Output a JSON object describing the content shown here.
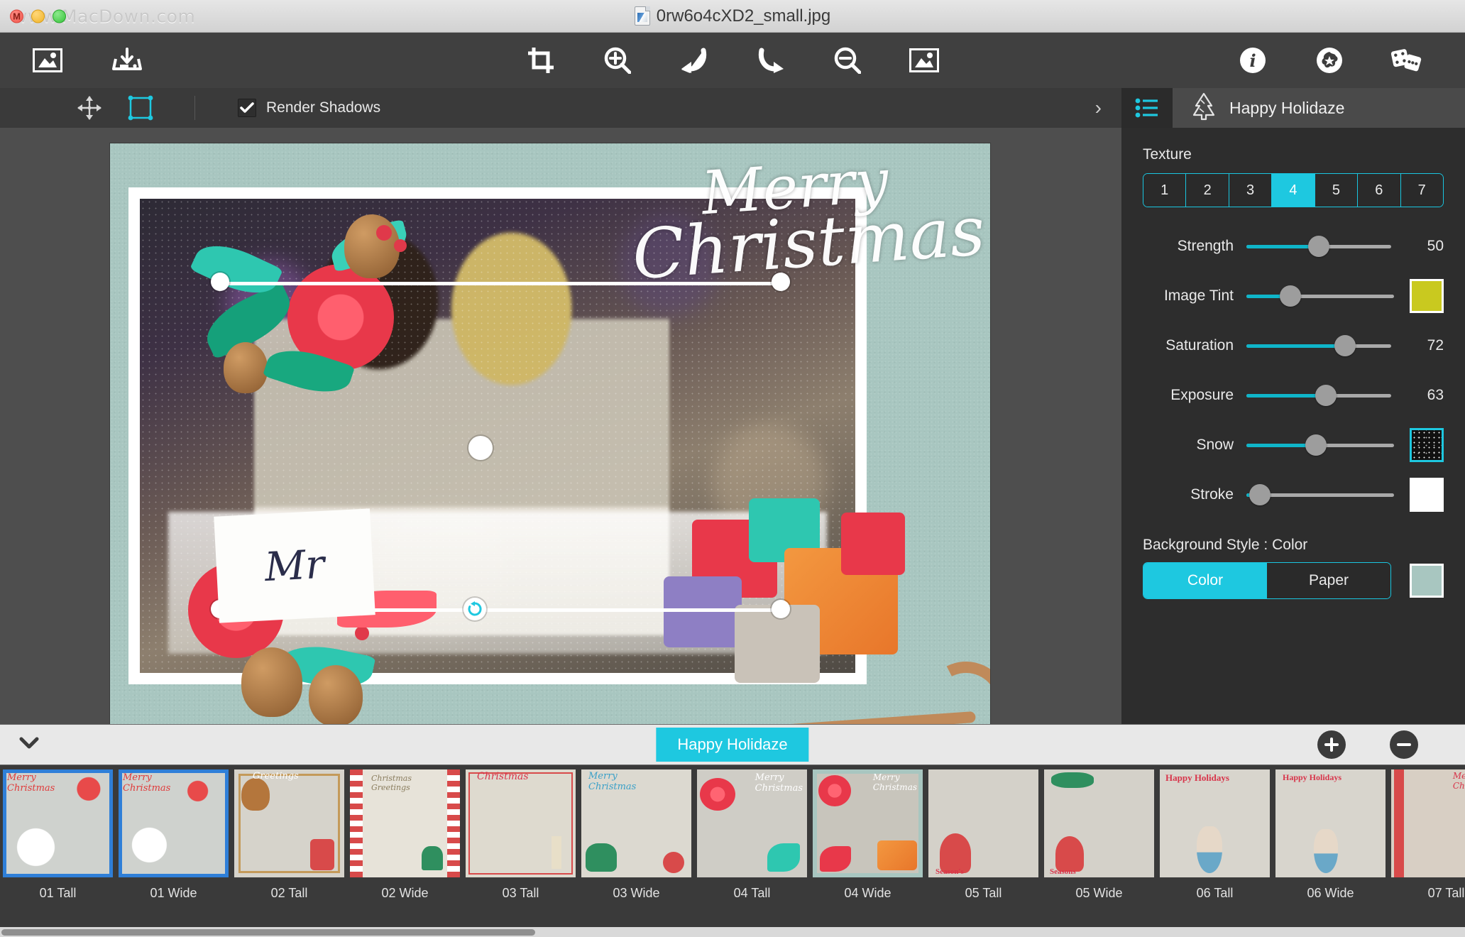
{
  "window": {
    "title": "0rw6o4cXD2_small.jpg",
    "watermark": "www.MacDown.com",
    "traffic_lights": [
      "close-red",
      "minimize-yellow",
      "zoom-green"
    ],
    "accent_color": "#1ec8e0"
  },
  "toolbar": {
    "left": [
      {
        "name": "open-image-icon",
        "label": "Open Image"
      },
      {
        "name": "save-image-icon",
        "label": "Save Image"
      }
    ],
    "center": [
      {
        "name": "crop-icon",
        "label": "Crop"
      },
      {
        "name": "zoom-in-icon",
        "label": "Zoom In"
      },
      {
        "name": "undo-icon",
        "label": "Undo"
      },
      {
        "name": "redo-icon",
        "label": "Redo"
      },
      {
        "name": "zoom-out-icon",
        "label": "Zoom Out"
      },
      {
        "name": "fit-image-icon",
        "label": "Fit Image"
      }
    ],
    "right": [
      {
        "name": "info-icon",
        "label": "Info"
      },
      {
        "name": "effects-icon",
        "label": "Effects"
      },
      {
        "name": "randomize-dice-icon",
        "label": "Randomize"
      }
    ]
  },
  "options_bar": {
    "move_tool": "move-tool",
    "transform_tool": "transform-tool",
    "render_shadows_label": "Render Shadows",
    "render_shadows_checked": true,
    "expand_chevron": "›"
  },
  "panel_header": {
    "list_icon": "list-icon",
    "tree_icon": "christmas-tree-icon",
    "title": "Happy Holidaze"
  },
  "panel": {
    "texture": {
      "label": "Texture",
      "options": [
        "1",
        "2",
        "3",
        "4",
        "5",
        "6",
        "7"
      ],
      "selected": "4"
    },
    "sliders": [
      {
        "label": "Strength",
        "value": 50,
        "percent": 50,
        "show_value": true,
        "swatch": null
      },
      {
        "label": "Image Tint",
        "value": 30,
        "percent": 30,
        "show_value": false,
        "swatch": "#c9c91f"
      },
      {
        "label": "Saturation",
        "value": 72,
        "percent": 72,
        "show_value": true,
        "swatch": null
      },
      {
        "label": "Exposure",
        "value": 63,
        "percent": 63,
        "show_value": true,
        "swatch": null
      },
      {
        "label": "Snow",
        "value": 47,
        "percent": 47,
        "show_value": false,
        "swatch": "noise"
      },
      {
        "label": "Stroke",
        "value": 9,
        "percent": 9,
        "show_value": false,
        "swatch": "#ffffff"
      }
    ],
    "background_style": {
      "label": "Background Style : Color",
      "options": [
        "Color",
        "Paper"
      ],
      "selected": "Color",
      "color": "#a8c6c0"
    }
  },
  "canvas": {
    "background_color": "#a8c6c0",
    "greeting_line1": "Merry",
    "greeting_line2": "Christmas",
    "monogram": "Mr",
    "selection_handles": 4,
    "rotate_handle_icon": "rotate-icon"
  },
  "filmstrip": {
    "collapse_icon": "chevron-down-icon",
    "active_tab": "Happy Holidaze",
    "add_button": "add-icon",
    "remove_button": "remove-icon",
    "templates": [
      {
        "label": "01 Tall",
        "selected": false,
        "focused": true
      },
      {
        "label": "01 Wide",
        "selected": false,
        "focused": true
      },
      {
        "label": "02 Tall",
        "selected": false,
        "focused": false
      },
      {
        "label": "02 Wide",
        "selected": false,
        "focused": false
      },
      {
        "label": "03 Tall",
        "selected": false,
        "focused": false
      },
      {
        "label": "03 Wide",
        "selected": false,
        "focused": false
      },
      {
        "label": "04 Tall",
        "selected": false,
        "focused": false
      },
      {
        "label": "04 Wide",
        "selected": true,
        "focused": false
      },
      {
        "label": "05 Tall",
        "selected": false,
        "focused": false
      },
      {
        "label": "05 Wide",
        "selected": false,
        "focused": false
      },
      {
        "label": "06 Tall",
        "selected": false,
        "focused": false
      },
      {
        "label": "06 Wide",
        "selected": false,
        "focused": false
      },
      {
        "label": "07 Tall",
        "selected": false,
        "focused": false
      }
    ]
  }
}
